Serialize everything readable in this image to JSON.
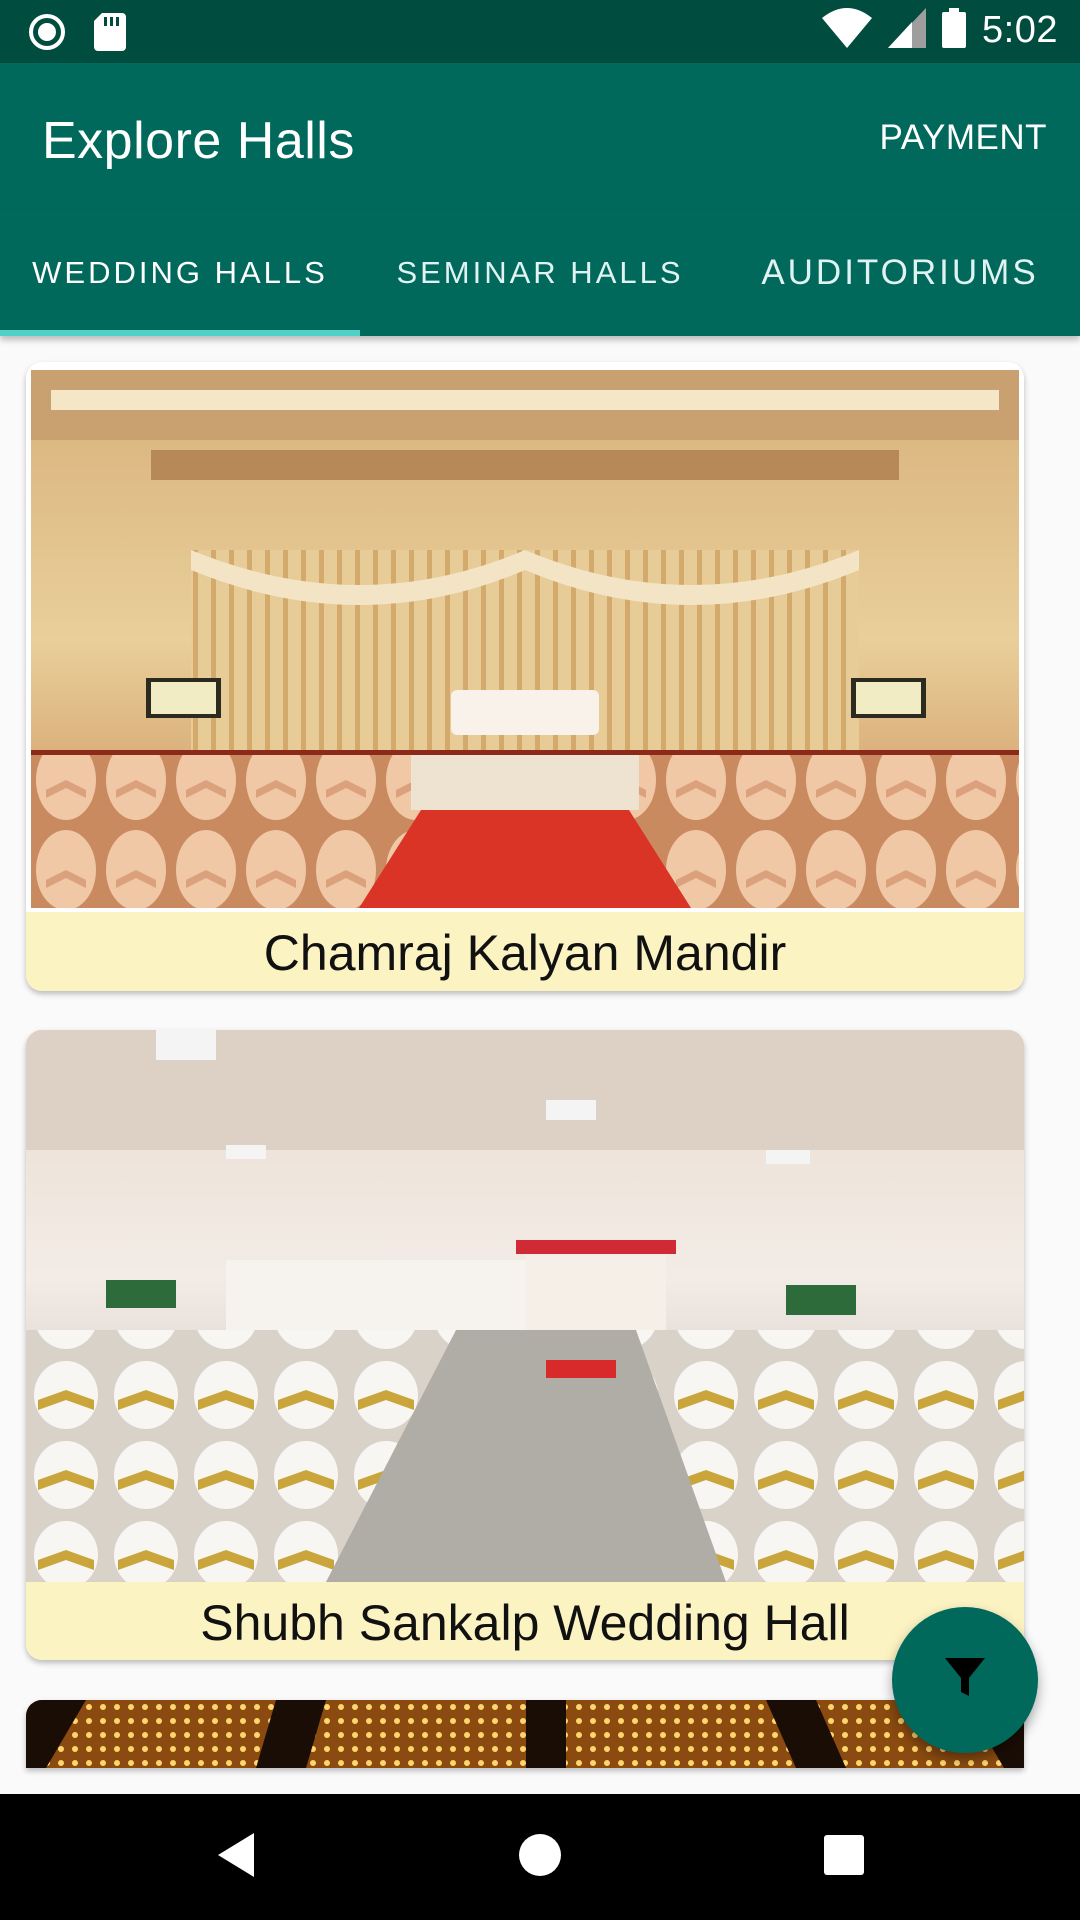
{
  "status_bar": {
    "time": "5:02",
    "icons": [
      "record-icon",
      "sd-card-icon",
      "wifi-icon",
      "signal-icon",
      "battery-icon"
    ]
  },
  "app_bar": {
    "title": "Explore Halls",
    "action_label": "PAYMENT"
  },
  "tabs": [
    {
      "label": "WEDDING HALLS",
      "selected": true
    },
    {
      "label": "SEMINAR HALLS",
      "selected": false
    },
    {
      "label": "AUDITORIUMS",
      "selected": false
    }
  ],
  "halls": [
    {
      "name": "Chamraj Kalyan Mandir"
    },
    {
      "name": "Shubh Sankalp Wedding Hall"
    },
    {
      "name": ""
    }
  ],
  "fab": {
    "icon": "filter-icon"
  },
  "nav_bar": {
    "icons": [
      "back-icon",
      "home-icon",
      "recents-icon"
    ]
  },
  "colors": {
    "primary": "#00695c",
    "primary_dark": "#004d40",
    "accent": "#4fd1c5",
    "caption_bg": "#fbf3c2"
  }
}
